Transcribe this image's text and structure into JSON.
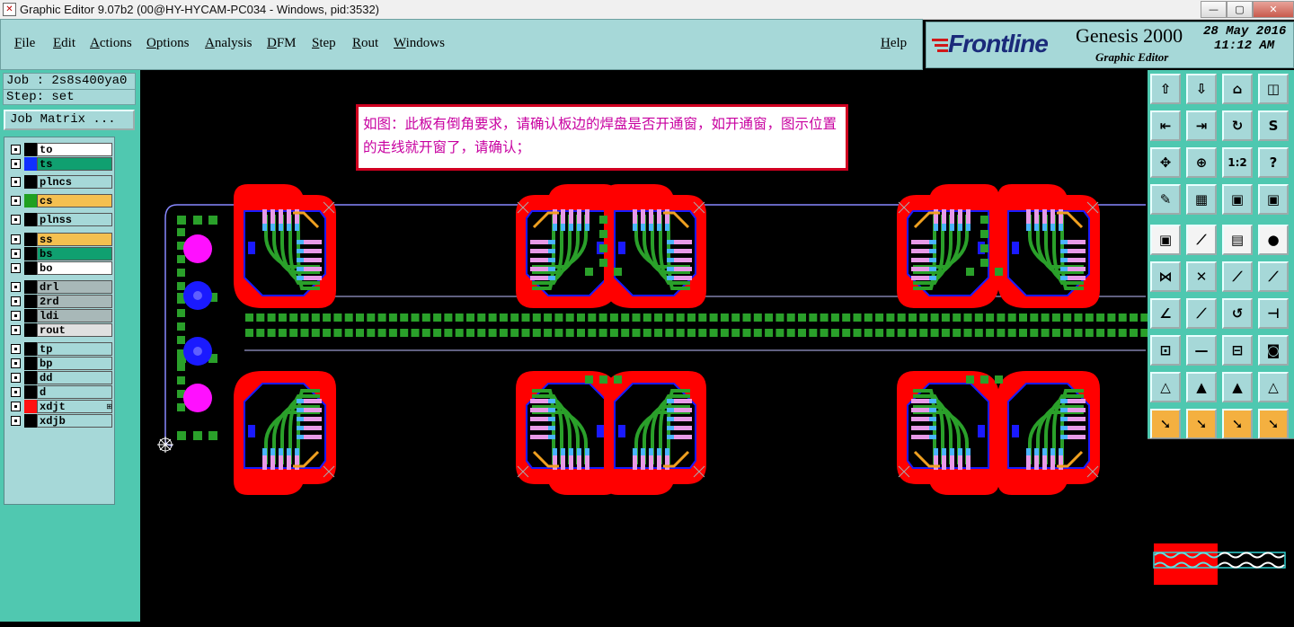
{
  "window": {
    "title": "Graphic Editor 9.07b2 (00@HY-HYCAM-PC034 - Windows, pid:3532)",
    "app_icon_glyph": "✕",
    "controls": {
      "minimize": "—",
      "maximize": "▢",
      "close": "✕"
    }
  },
  "menu": {
    "items": [
      "File",
      "Edit",
      "Actions",
      "Options",
      "Analysis",
      "DFM",
      "Step",
      "Rout",
      "Windows"
    ],
    "help": "Help"
  },
  "brand": {
    "logo": "Frontline",
    "product": "Genesis 2000",
    "subtitle": "Graphic Editor",
    "date": "28 May 2016",
    "time": "11:12 AM",
    "logo_color": "#1a2a7a"
  },
  "job": {
    "job_line": "Job : 2s8s400ya0",
    "step_line": "Step: set",
    "matrix_button": "Job Matrix ..."
  },
  "layers": [
    {
      "name": "to",
      "swatch": "#000000",
      "bg": "#ffffff",
      "checked": true
    },
    {
      "name": "ts",
      "swatch": "#1030ff",
      "bg": "#10a070",
      "checked": true
    },
    {
      "name": "plncs",
      "swatch": "#000000",
      "bg": "#a6d8d8",
      "checked": true
    },
    {
      "name": "cs",
      "swatch": "#20a020",
      "bg": "#f4c050",
      "checked": true
    },
    {
      "name": "plnss",
      "swatch": "#000000",
      "bg": "#a6d8d8",
      "checked": true
    },
    {
      "name": "ss",
      "swatch": "#000000",
      "bg": "#f4c050",
      "checked": true
    },
    {
      "name": "bs",
      "swatch": "#000000",
      "bg": "#10a070",
      "checked": true
    },
    {
      "name": "bo",
      "swatch": "#000000",
      "bg": "#ffffff",
      "checked": true
    },
    {
      "name": "drl",
      "swatch": "#000000",
      "bg": "#a8b8b8",
      "checked": true
    },
    {
      "name": "2rd",
      "swatch": "#000000",
      "bg": "#a8b8b8",
      "checked": true
    },
    {
      "name": "ldi",
      "swatch": "#000000",
      "bg": "#a8b8b8",
      "checked": true
    },
    {
      "name": "rout",
      "swatch": "#000000",
      "bg": "#e0e0e0",
      "checked": true
    },
    {
      "name": "tp",
      "swatch": "#000000",
      "bg": "#a6d8d8",
      "checked": true
    },
    {
      "name": "bp",
      "swatch": "#000000",
      "bg": "#a6d8d8",
      "checked": true
    },
    {
      "name": "dd",
      "swatch": "#000000",
      "bg": "#a6d8d8",
      "checked": true
    },
    {
      "name": "d",
      "swatch": "#000000",
      "bg": "#a6d8d8",
      "checked": true
    },
    {
      "name": "xdjt",
      "swatch": "#ff1010",
      "bg": "#a6d8d8",
      "checked": true,
      "marker": "⊞"
    },
    {
      "name": "xdjb",
      "swatch": "#000000",
      "bg": "#a6d8d8",
      "checked": true
    }
  ],
  "canvas": {
    "note": "如图：此板有倒角要求，请确认板边的焊盘是否开通窗，如开通窗，图示位置的走线就开窗了，请确认；",
    "colors": {
      "mask": "#ff0000",
      "trace": "#2aa02a",
      "pad": "#e89ae8",
      "pad_blue": "#4ab4ff",
      "outline": "#1a1aff",
      "via": "#ff10ff",
      "via_blue": "#1a1aff"
    }
  },
  "tools": [
    {
      "icon": "export-up-icon",
      "glyph": "⇧",
      "style": "cyan"
    },
    {
      "icon": "import-down-icon",
      "glyph": "⇩",
      "style": "cyan"
    },
    {
      "icon": "home-icon",
      "glyph": "⌂",
      "style": "cyan"
    },
    {
      "icon": "window-split-icon",
      "glyph": "◫",
      "style": "cyan"
    },
    {
      "icon": "arrow-in-left-icon",
      "glyph": "⇤",
      "style": "cyan"
    },
    {
      "icon": "arrow-in-right-icon",
      "glyph": "⇥",
      "style": "cyan"
    },
    {
      "icon": "mirror-icon",
      "glyph": "↻",
      "style": "cyan"
    },
    {
      "icon": "snake-icon",
      "glyph": "S",
      "style": "cyan"
    },
    {
      "icon": "zoom-fit-icon",
      "glyph": "✥",
      "style": "cyan"
    },
    {
      "icon": "zoom-center-icon",
      "glyph": "⊕",
      "style": "cyan"
    },
    {
      "icon": "scale-1-2-icon",
      "glyph": "1:2",
      "style": "cyan"
    },
    {
      "icon": "help-icon",
      "glyph": "?",
      "style": "cyan"
    },
    {
      "icon": "tools-icon",
      "glyph": "✎",
      "style": "cyan"
    },
    {
      "icon": "grid-icon",
      "glyph": "▦",
      "style": "cyan"
    },
    {
      "icon": "layers-red-icon",
      "glyph": "▣",
      "style": "cyan"
    },
    {
      "icon": "layers-red-alt-icon",
      "glyph": "▣",
      "style": "cyan"
    },
    {
      "icon": "pad-square-icon",
      "glyph": "▣",
      "style": "white"
    },
    {
      "icon": "line-draw-icon",
      "glyph": "⟋",
      "style": "white"
    },
    {
      "icon": "ruler-icon",
      "glyph": "▤",
      "style": "white"
    },
    {
      "icon": "circle-pad-icon",
      "glyph": "●",
      "style": "white"
    },
    {
      "icon": "connect-nodes-icon",
      "glyph": "⋈",
      "style": "cyan"
    },
    {
      "icon": "cross-icon",
      "glyph": "✕",
      "style": "cyan"
    },
    {
      "icon": "route-line-icon",
      "glyph": "⟋",
      "style": "cyan"
    },
    {
      "icon": "route-line-alt-icon",
      "glyph": "⟋",
      "style": "cyan"
    },
    {
      "icon": "angle-icon",
      "glyph": "∠",
      "style": "cyan"
    },
    {
      "icon": "diagonal-icon",
      "glyph": "⟋",
      "style": "cyan"
    },
    {
      "icon": "rotate-icon",
      "glyph": "↺",
      "style": "cyan"
    },
    {
      "icon": "bracket-icon",
      "glyph": "⊣",
      "style": "cyan"
    },
    {
      "icon": "move-pad-icon",
      "glyph": "⊡",
      "style": "cyan"
    },
    {
      "icon": "line-cut-icon",
      "glyph": "—",
      "style": "cyan"
    },
    {
      "icon": "measure-icon",
      "glyph": "⊟",
      "style": "cyan"
    },
    {
      "icon": "shapes-icon",
      "glyph": "◙",
      "style": "cyan"
    },
    {
      "icon": "triangle-up-icon",
      "glyph": "△",
      "style": "cyan"
    },
    {
      "icon": "triangle-arrow-icon",
      "glyph": "▲",
      "style": "cyan"
    },
    {
      "icon": "triangle-red-icon",
      "glyph": "▲",
      "style": "cyan"
    },
    {
      "icon": "triangle-line-icon",
      "glyph": "△",
      "style": "cyan"
    },
    {
      "icon": "pointer-icon",
      "glyph": "➘",
      "style": "orange"
    },
    {
      "icon": "pointer-box-icon",
      "glyph": "➘",
      "style": "orange"
    },
    {
      "icon": "pointer-circle-icon",
      "glyph": "➘",
      "style": "orange"
    },
    {
      "icon": "pointer-path-icon",
      "glyph": "➘",
      "style": "orange"
    }
  ]
}
